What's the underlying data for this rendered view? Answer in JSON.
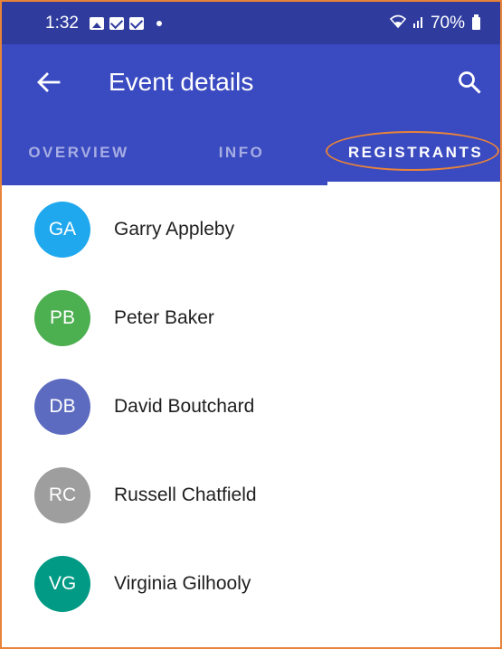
{
  "status_bar": {
    "time": "1:32",
    "battery": "70%",
    "icons": [
      "photo-icon",
      "mail-icon",
      "mail-icon",
      "dot-icon",
      "wifi-icon",
      "signal-icon",
      "battery-icon"
    ]
  },
  "app_bar": {
    "title": "Event details",
    "back_icon": "arrow-left-icon",
    "search_icon": "search-icon",
    "color": "#3a4ac0"
  },
  "tabs": [
    {
      "label": "OVERVIEW",
      "active": false
    },
    {
      "label": "INFO",
      "active": false
    },
    {
      "label": "REGISTRANTS",
      "active": true
    }
  ],
  "registrants": [
    {
      "initials": "GA",
      "name": "Garry Appleby",
      "color": "#1fa8ee"
    },
    {
      "initials": "PB",
      "name": "Peter Baker",
      "color": "#4caf50"
    },
    {
      "initials": "DB",
      "name": "David Boutchard",
      "color": "#5c6bc0"
    },
    {
      "initials": "RC",
      "name": "Russell Chatfield",
      "color": "#9e9e9e"
    },
    {
      "initials": "VG",
      "name": "Virginia Gilhooly",
      "color": "#009a85"
    }
  ],
  "annotation_color": "#e8833a"
}
